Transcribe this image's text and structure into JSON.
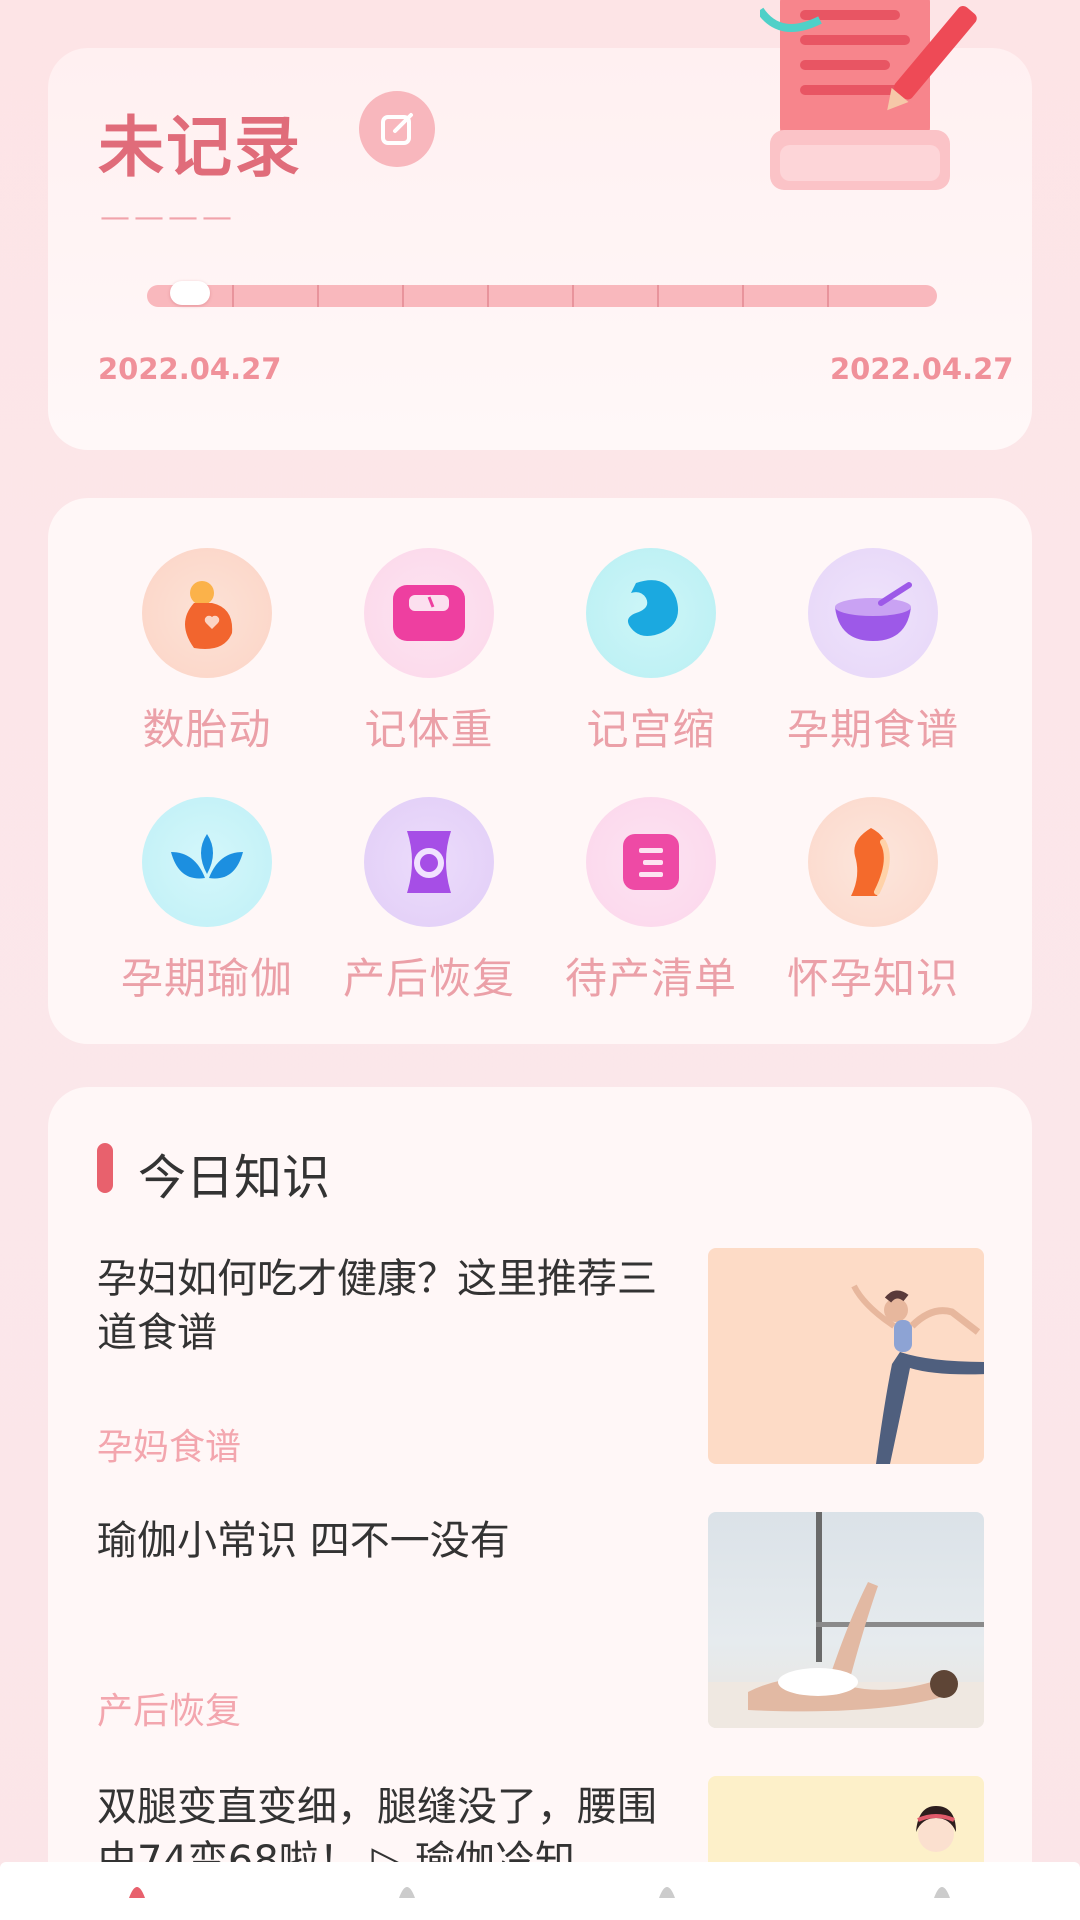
{
  "record": {
    "title": "未记录",
    "dash": "————",
    "date_start": "2022.04.27",
    "date_end": "2022.04.27",
    "progress": 0.02
  },
  "tools": [
    {
      "label": "数胎动",
      "icon": "belly-icon"
    },
    {
      "label": "记体重",
      "icon": "scale-icon"
    },
    {
      "label": "记宫缩",
      "icon": "uterus-icon"
    },
    {
      "label": "孕期食谱",
      "icon": "bowl-icon"
    },
    {
      "label": "孕期瑜伽",
      "icon": "lotus-icon"
    },
    {
      "label": "产后恢复",
      "icon": "waist-icon"
    },
    {
      "label": "待产清单",
      "icon": "list-icon"
    },
    {
      "label": "怀孕知识",
      "icon": "pregnant-icon"
    }
  ],
  "knowledge": {
    "title": "今日知识",
    "articles": [
      {
        "title": "孕妇如何吃才健康？这里推荐三道食谱",
        "tag": "孕妈食谱"
      },
      {
        "title": "瑜伽小常识 四不一没有",
        "tag": "产后恢复"
      },
      {
        "title": "双腿变直变细，腿缝没了，腰围由74变68啦！ ▷ 瑜伽冷知",
        "tag": ""
      }
    ]
  },
  "colors": {
    "accent": "#e8616d",
    "title_pink": "#e06c7a",
    "label_pink": "#eba0a8",
    "track": "#f9b8bd"
  }
}
